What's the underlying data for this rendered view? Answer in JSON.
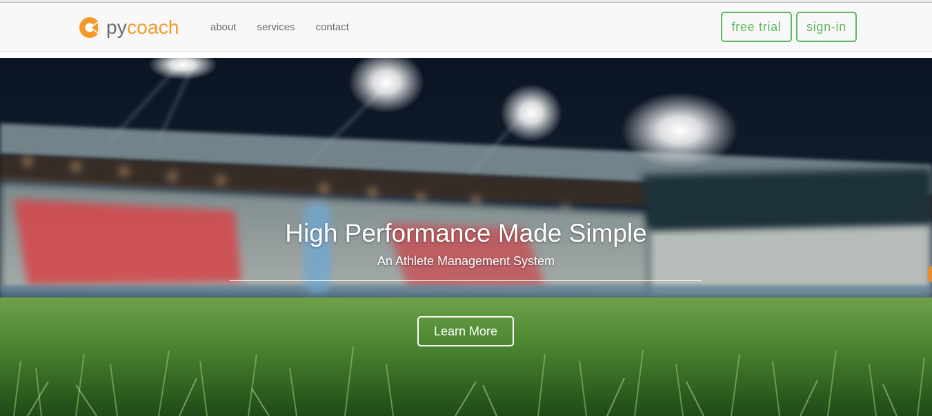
{
  "brand": {
    "name_part1": "py",
    "name_part2": "coach",
    "logo_icon": "pycoach-logo-icon",
    "color": "#f39a2b"
  },
  "nav": {
    "links": [
      {
        "label": "about"
      },
      {
        "label": "services"
      },
      {
        "label": "contact"
      }
    ],
    "free_trial_label": "free trial",
    "sign_in_label": "sign-in",
    "accent_color": "#5cb85c"
  },
  "hero": {
    "title": "High Performance Made Simple",
    "subtitle": "An Athlete Management System",
    "cta_label": "Learn More",
    "background": "stadium-night-grass-photo"
  }
}
